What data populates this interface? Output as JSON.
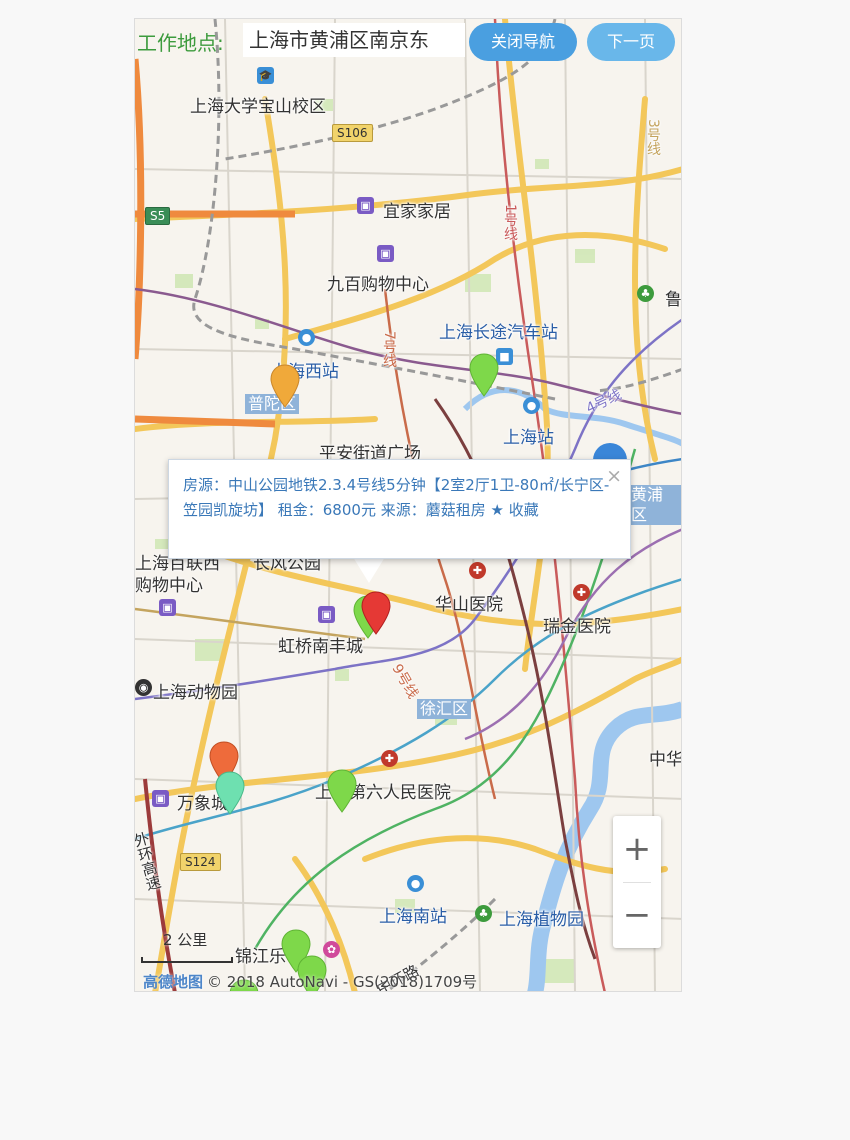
{
  "header": {
    "work_label": "工作地点:",
    "work_value": "上海市黄浦区南京东",
    "close_nav_button": "关闭导航",
    "next_page_button": "下一页"
  },
  "popup": {
    "text": "房源：中山公园地铁2.3.4号线5分钟【2室2厅1卫-80㎡/长宁区-笠园凯旋坊】 租金：6800元 来源：蘑菇租房",
    "favorite_label": "收藏",
    "close_symbol": "×"
  },
  "map_labels": {
    "shanghai_university": "上海大学宝山校区",
    "yijia": "宜家家居",
    "jiubai": "九百购物中心",
    "changtu": "上海长途汽车站",
    "west_station": "上海西站",
    "putuo": "普陀区",
    "shanghai_station": "上海站",
    "huangpu": "黄浦区",
    "huashan": "华山医院",
    "ruijin": "瑞金医院",
    "hongqiao_nanfeng": "虹桥南丰城",
    "zoo": "上海动物园",
    "xuhui": "徐汇区",
    "wanxiang": "万象城",
    "sixth_hospital": "上海第六人民医院",
    "south_station": "上海南站",
    "botanical": "上海植物园",
    "jinjiang": "锦江乐",
    "gubei_partial": "上海百联西",
    "gubei_partial2": "购物中心",
    "zhonghua": "中华",
    "lu_partial": "鲁",
    "zhongshan_park": "长风公园",
    "pingan": "平安街道广场",
    "line1": "1号线",
    "line3": "3号线",
    "line7": "7号线",
    "line4": "4号线",
    "line9": "9号线",
    "outer_ring": "外环高速",
    "zhongshan_road": "中环路"
  },
  "road_shields": {
    "s106": "S106",
    "s5": "S5",
    "s124": "S124"
  },
  "scale": "2 公里",
  "copyright": {
    "logo": "高德地图",
    "text": "© 2018 AutoNavi - GS(2018)1709号"
  },
  "zoom": {
    "in": "+",
    "out": "−"
  },
  "colors": {
    "button": "#5aaee6",
    "popup_text": "#3a78b8",
    "work_label": "#3d9b3d",
    "selected_pin": "#e53935",
    "pin_green": "#7ed84a",
    "pin_orange": "#f0a93a",
    "pin_red_orange": "#ee6b3b",
    "pin_teal": "#6ee0b0"
  }
}
